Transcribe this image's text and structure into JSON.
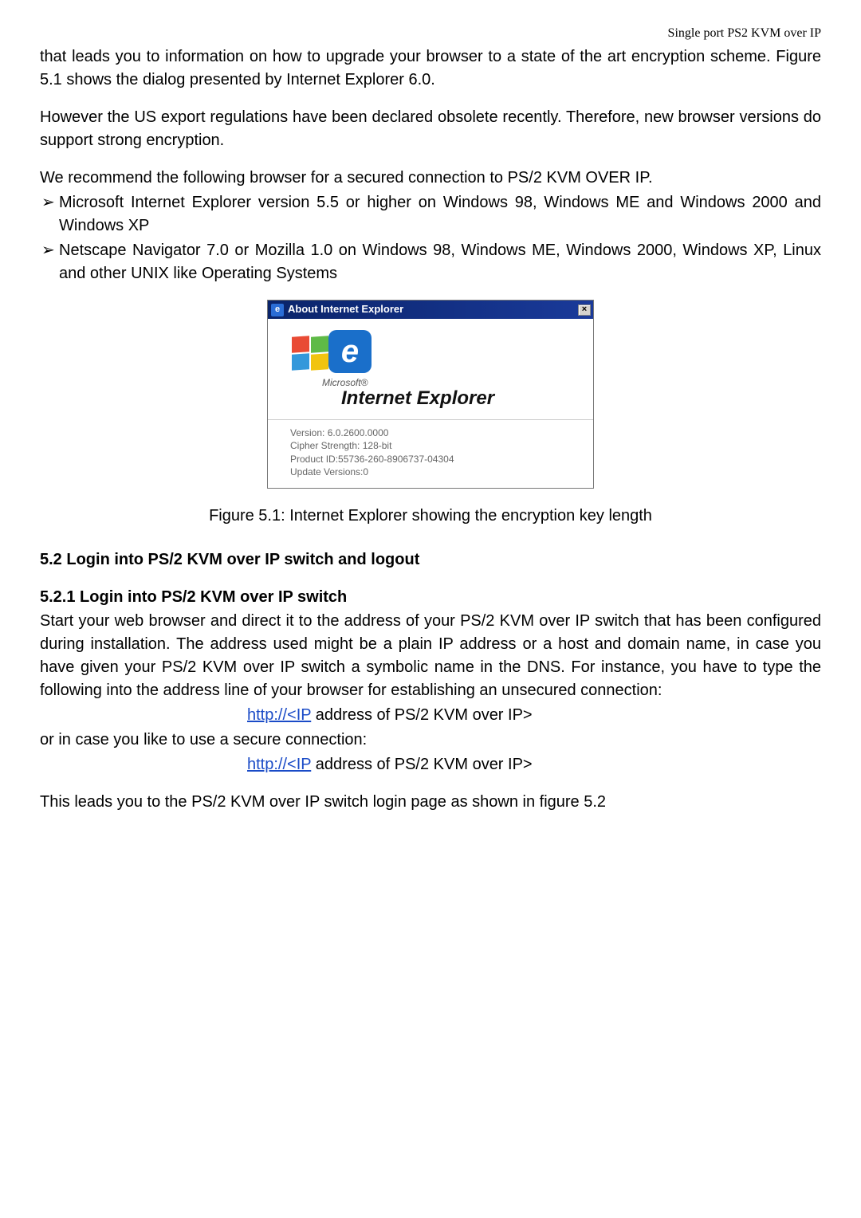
{
  "header": {
    "right": "Single port PS2 KVM over IP"
  },
  "para1": "that leads you to information on how to upgrade your browser to a state of the art encryption scheme. Figure 5.1 shows the dialog presented by Internet Explorer 6.0.",
  "para2": "However the US export regulations have been declared obsolete recently. Therefore, new browser versions do support strong encryption.",
  "para3": "We recommend the following browser for a secured connection to PS/2 KVM OVER IP.",
  "bullets": [
    "Microsoft Internet Explorer version 5.5 or higher on Windows 98, Windows ME and Windows 2000 and Windows XP",
    "Netscape Navigator 7.0 or Mozilla 1.0 on Windows 98, Windows ME, Windows 2000, Windows XP, Linux and other UNIX like Operating Systems"
  ],
  "dialog": {
    "title": "About Internet Explorer",
    "e_glyph": "e",
    "ms": "Microsoft®",
    "ie_word": "Internet Explorer",
    "line1": "Version: 6.0.2600.0000",
    "line2": "Cipher Strength: 128-bit",
    "line3": "Product ID:55736-260-8906737-04304",
    "line4": "Update Versions:0",
    "close": "×"
  },
  "fig_caption": "Figure 5.1: Internet Explorer showing the encryption key length",
  "h52": "5.2 Login into PS/2 KVM over IP switch and logout",
  "h521": "5.2.1 Login into PS/2 KVM over IP switch",
  "para4": "Start your web browser and direct it to the address of your PS/2 KVM over IP switch that has been configured during installation. The address used might be a plain IP address or a host and domain name, in case you have given your PS/2 KVM over IP switch a symbolic name in the DNS. For instance, you have to type the following into the address line of your browser for establishing an unsecured connection:",
  "link1_link": "http://<IP",
  "link1_rest": " address of PS/2 KVM over IP>",
  "para5": "or in case you like to use a secure connection:",
  "link2_link": "http://<IP",
  "link2_rest": " address of PS/2 KVM over IP>",
  "para6": "This leads you to the PS/2 KVM over IP switch login page as shown in figure 5.2"
}
